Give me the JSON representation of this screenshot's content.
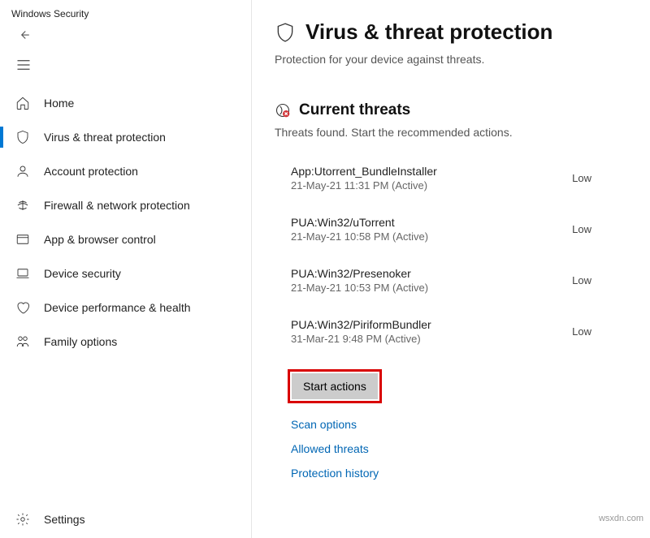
{
  "app_title": "Windows Security",
  "sidebar": {
    "items": [
      {
        "label": "Home"
      },
      {
        "label": "Virus & threat protection"
      },
      {
        "label": "Account protection"
      },
      {
        "label": "Firewall & network protection"
      },
      {
        "label": "App & browser control"
      },
      {
        "label": "Device security"
      },
      {
        "label": "Device performance & health"
      },
      {
        "label": "Family options"
      }
    ],
    "settings_label": "Settings"
  },
  "page": {
    "title": "Virus & threat protection",
    "subtitle": "Protection for your device against threats."
  },
  "current_threats": {
    "heading": "Current threats",
    "subtitle": "Threats found. Start the recommended actions.",
    "items": [
      {
        "name": "App:Utorrent_BundleInstaller",
        "date": "21-May-21 11:31 PM (Active)",
        "severity": "Low"
      },
      {
        "name": "PUA:Win32/uTorrent",
        "date": "21-May-21 10:58 PM (Active)",
        "severity": "Low"
      },
      {
        "name": "PUA:Win32/Presenoker",
        "date": "21-May-21 10:53 PM (Active)",
        "severity": "Low"
      },
      {
        "name": "PUA:Win32/PiriformBundler",
        "date": "31-Mar-21 9:48 PM (Active)",
        "severity": "Low"
      }
    ],
    "start_actions_label": "Start actions",
    "links": {
      "scan_options": "Scan options",
      "allowed_threats": "Allowed threats",
      "protection_history": "Protection history"
    }
  },
  "watermark": "wsxdn.com"
}
